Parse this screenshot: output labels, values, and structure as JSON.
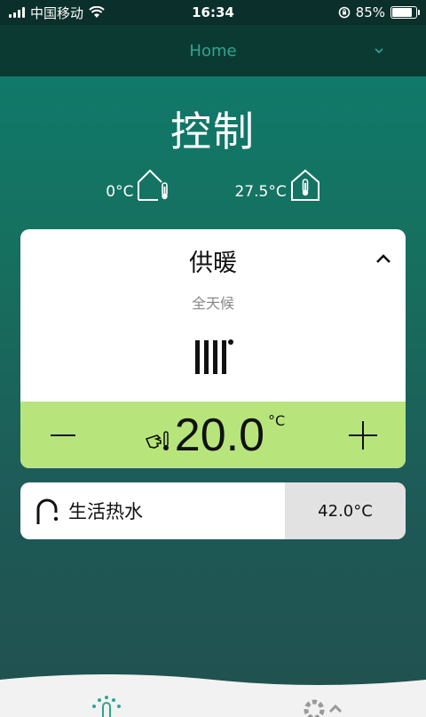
{
  "status_bar": {
    "carrier": "中国移动",
    "time": "16:34",
    "battery_percent": "85%",
    "battery_level": 0.85
  },
  "header": {
    "home_label": "Home",
    "icon": "chevron-down-icon"
  },
  "page": {
    "title": "控制"
  },
  "temperatures": {
    "outdoor": "0°C",
    "outdoor_icon": "outdoor-thermometer-icon",
    "indoor": "27.5°C",
    "indoor_icon": "indoor-thermometer-icon"
  },
  "heating": {
    "title": "供暖",
    "mode": "全天候",
    "icon": "radiator-icon",
    "setpoint": "20.0",
    "unit": "°C",
    "minus_icon": "minus-icon",
    "plus_icon": "plus-icon",
    "manual_icon": "manual-hand-icon"
  },
  "hot_water": {
    "label": "生活热水",
    "value": "42.0°C",
    "icon": "faucet-icon"
  },
  "colors": {
    "accent": "#2fa48f",
    "control_bar": "#b7e57b",
    "header_bg": "#0b3a33"
  }
}
